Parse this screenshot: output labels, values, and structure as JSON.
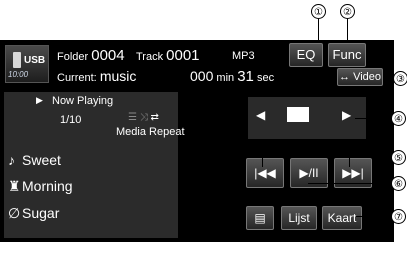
{
  "header": {
    "source_label": "USB",
    "clock": "10:00",
    "folder_label": "Folder",
    "folder_value": "0004",
    "track_label": "Track",
    "track_value": "0001",
    "format": "MP3",
    "current_label": "Current:",
    "current_value": "music",
    "elapsed_min": "000",
    "min_label": "min",
    "elapsed_sec": "31",
    "sec_label": "sec"
  },
  "buttons": {
    "eq": "EQ",
    "func": "Func",
    "video": "Video",
    "list": "Lijst",
    "map": "Kaart"
  },
  "now_playing": {
    "label": "Now Playing",
    "position": "1/10",
    "media": "Media",
    "repeat": "Repeat"
  },
  "tracks": [
    {
      "icon": "music-note-icon",
      "title": "Sweet"
    },
    {
      "icon": "artist-icon",
      "title": "Morning"
    },
    {
      "icon": "album-icon",
      "title": "Sugar"
    }
  ],
  "callouts": [
    "①",
    "②",
    "③",
    "④",
    "⑤",
    "⑥",
    "⑦"
  ]
}
